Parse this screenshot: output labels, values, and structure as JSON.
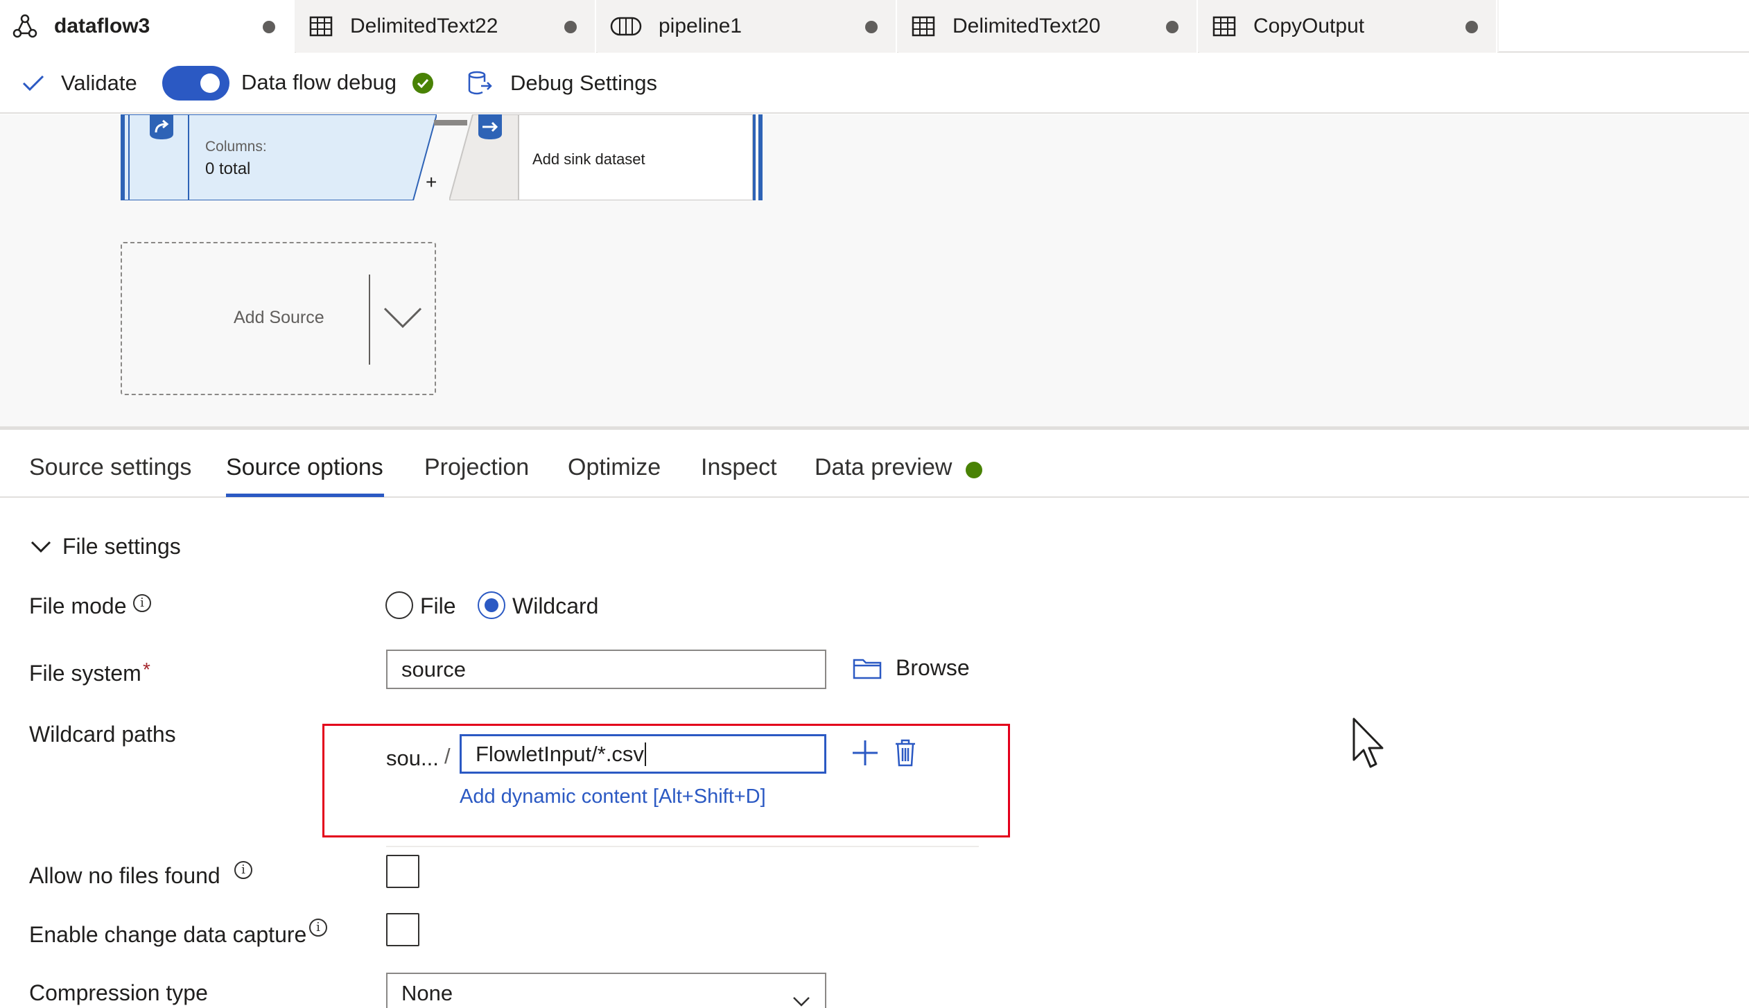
{
  "tabs": [
    {
      "label": "dataflow3",
      "icon": "dataflow-icon",
      "active": true
    },
    {
      "label": "DelimitedText22",
      "icon": "table-icon",
      "active": false
    },
    {
      "label": "pipeline1",
      "icon": "pipeline-icon",
      "active": false
    },
    {
      "label": "DelimitedText20",
      "icon": "table-icon",
      "active": false
    },
    {
      "label": "CopyOutput",
      "icon": "table-icon",
      "active": false
    }
  ],
  "toolbar": {
    "validate_label": "Validate",
    "debug_label": "Data flow debug",
    "debug_settings_label": "Debug Settings",
    "debug_on": true
  },
  "canvas": {
    "source_node": {
      "columns_label": "Columns:",
      "columns_value": "0 total"
    },
    "add_node_symbol": "+",
    "sink_node": {
      "label": "Add sink dataset"
    },
    "add_source_label": "Add Source"
  },
  "panel_tabs": [
    {
      "label": "Source settings"
    },
    {
      "label": "Source options",
      "active": true
    },
    {
      "label": "Projection"
    },
    {
      "label": "Optimize"
    },
    {
      "label": "Inspect"
    },
    {
      "label": "Data preview"
    }
  ],
  "file_settings": {
    "section_title": "File settings",
    "file_mode": {
      "label": "File mode",
      "options": [
        "File",
        "Wildcard"
      ],
      "selected": "Wildcard"
    },
    "file_system": {
      "label": "File system",
      "required_mark": "*",
      "value": "source",
      "browse_label": "Browse"
    },
    "wildcard_paths": {
      "label": "Wildcard paths",
      "prefix": "sou...",
      "separator": "/",
      "value": "FlowletInput/*.csv",
      "dynamic_content_link": "Add dynamic content [Alt+Shift+D]"
    },
    "allow_no_files": {
      "label": "Allow no files found",
      "checked": false
    },
    "change_data_capture": {
      "label": "Enable change data capture",
      "checked": false
    },
    "compression_type": {
      "label": "Compression type",
      "value": "None"
    }
  },
  "colors": {
    "accent": "#2b59c3",
    "node_blue": "#2e63b6",
    "success_green": "#498205",
    "highlight_red": "#e3001b",
    "link_blue": "#2b59c3"
  }
}
